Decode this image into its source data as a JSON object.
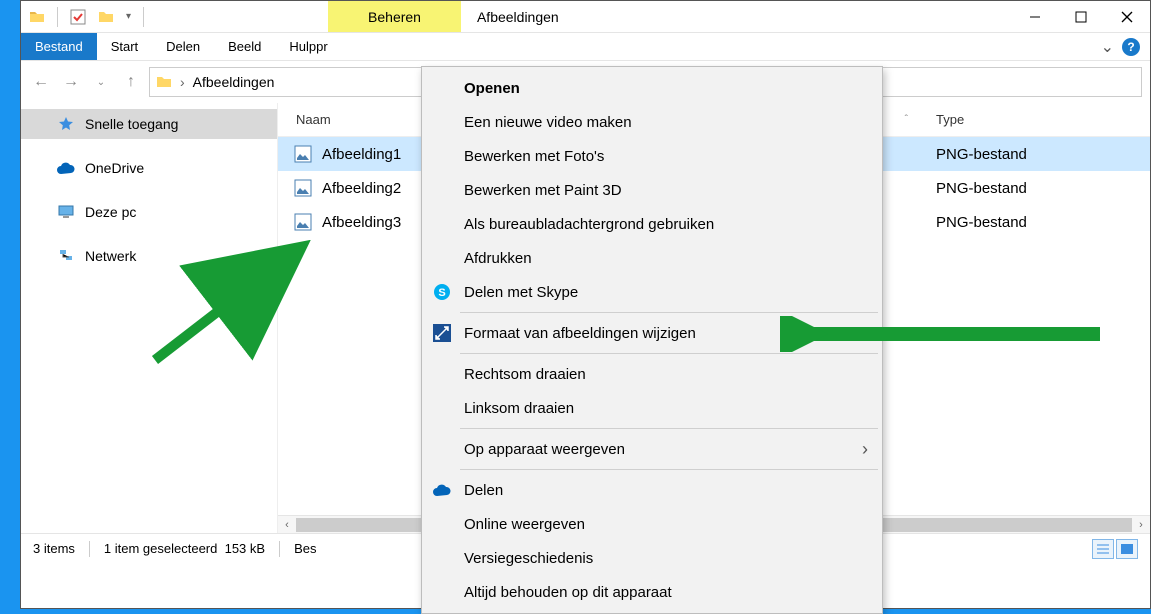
{
  "title": "Afbeeldingen",
  "ctx_tab": "Beheren",
  "ribbon": {
    "tabs": [
      "Bestand",
      "Start",
      "Delen",
      "Beeld",
      "Hulppr"
    ],
    "active": 0
  },
  "breadcrumb": {
    "segments": [
      "Afbeeldingen"
    ]
  },
  "sidebar": {
    "items": [
      {
        "label": "Snelle toegang",
        "icon": "star"
      },
      {
        "label": "OneDrive",
        "icon": "cloud"
      },
      {
        "label": "Deze pc",
        "icon": "pc"
      },
      {
        "label": "Netwerk",
        "icon": "net"
      }
    ]
  },
  "columns": {
    "name": "Naam",
    "type": "Type"
  },
  "files": [
    {
      "name": "Afbeelding1",
      "type": "PNG-bestand",
      "selected": true
    },
    {
      "name": "Afbeelding2",
      "type": "PNG-bestand",
      "selected": false
    },
    {
      "name": "Afbeelding3",
      "type": "PNG-bestand",
      "selected": false
    }
  ],
  "status": {
    "count": "3 items",
    "selection": "1 item geselecteerd",
    "size": "153 kB",
    "extra": "Bes"
  },
  "context_menu": {
    "groups": [
      [
        {
          "label": "Openen",
          "bold": true
        },
        {
          "label": "Een nieuwe video maken"
        },
        {
          "label": "Bewerken met Foto's"
        },
        {
          "label": "Bewerken met Paint 3D"
        },
        {
          "label": "Als bureaubladachtergrond gebruiken"
        },
        {
          "label": "Afdrukken"
        },
        {
          "label": "Delen met Skype",
          "icon": "skype"
        }
      ],
      [
        {
          "label": "Formaat van afbeeldingen wijzigen",
          "icon": "resize"
        }
      ],
      [
        {
          "label": "Rechtsom draaien"
        },
        {
          "label": "Linksom draaien"
        }
      ],
      [
        {
          "label": "Op apparaat weergeven",
          "submenu": true
        }
      ],
      [
        {
          "label": "Delen",
          "icon": "cloud"
        },
        {
          "label": "Online weergeven"
        },
        {
          "label": "Versiegeschiedenis"
        },
        {
          "label": "Altijd behouden op dit apparaat"
        }
      ]
    ]
  }
}
